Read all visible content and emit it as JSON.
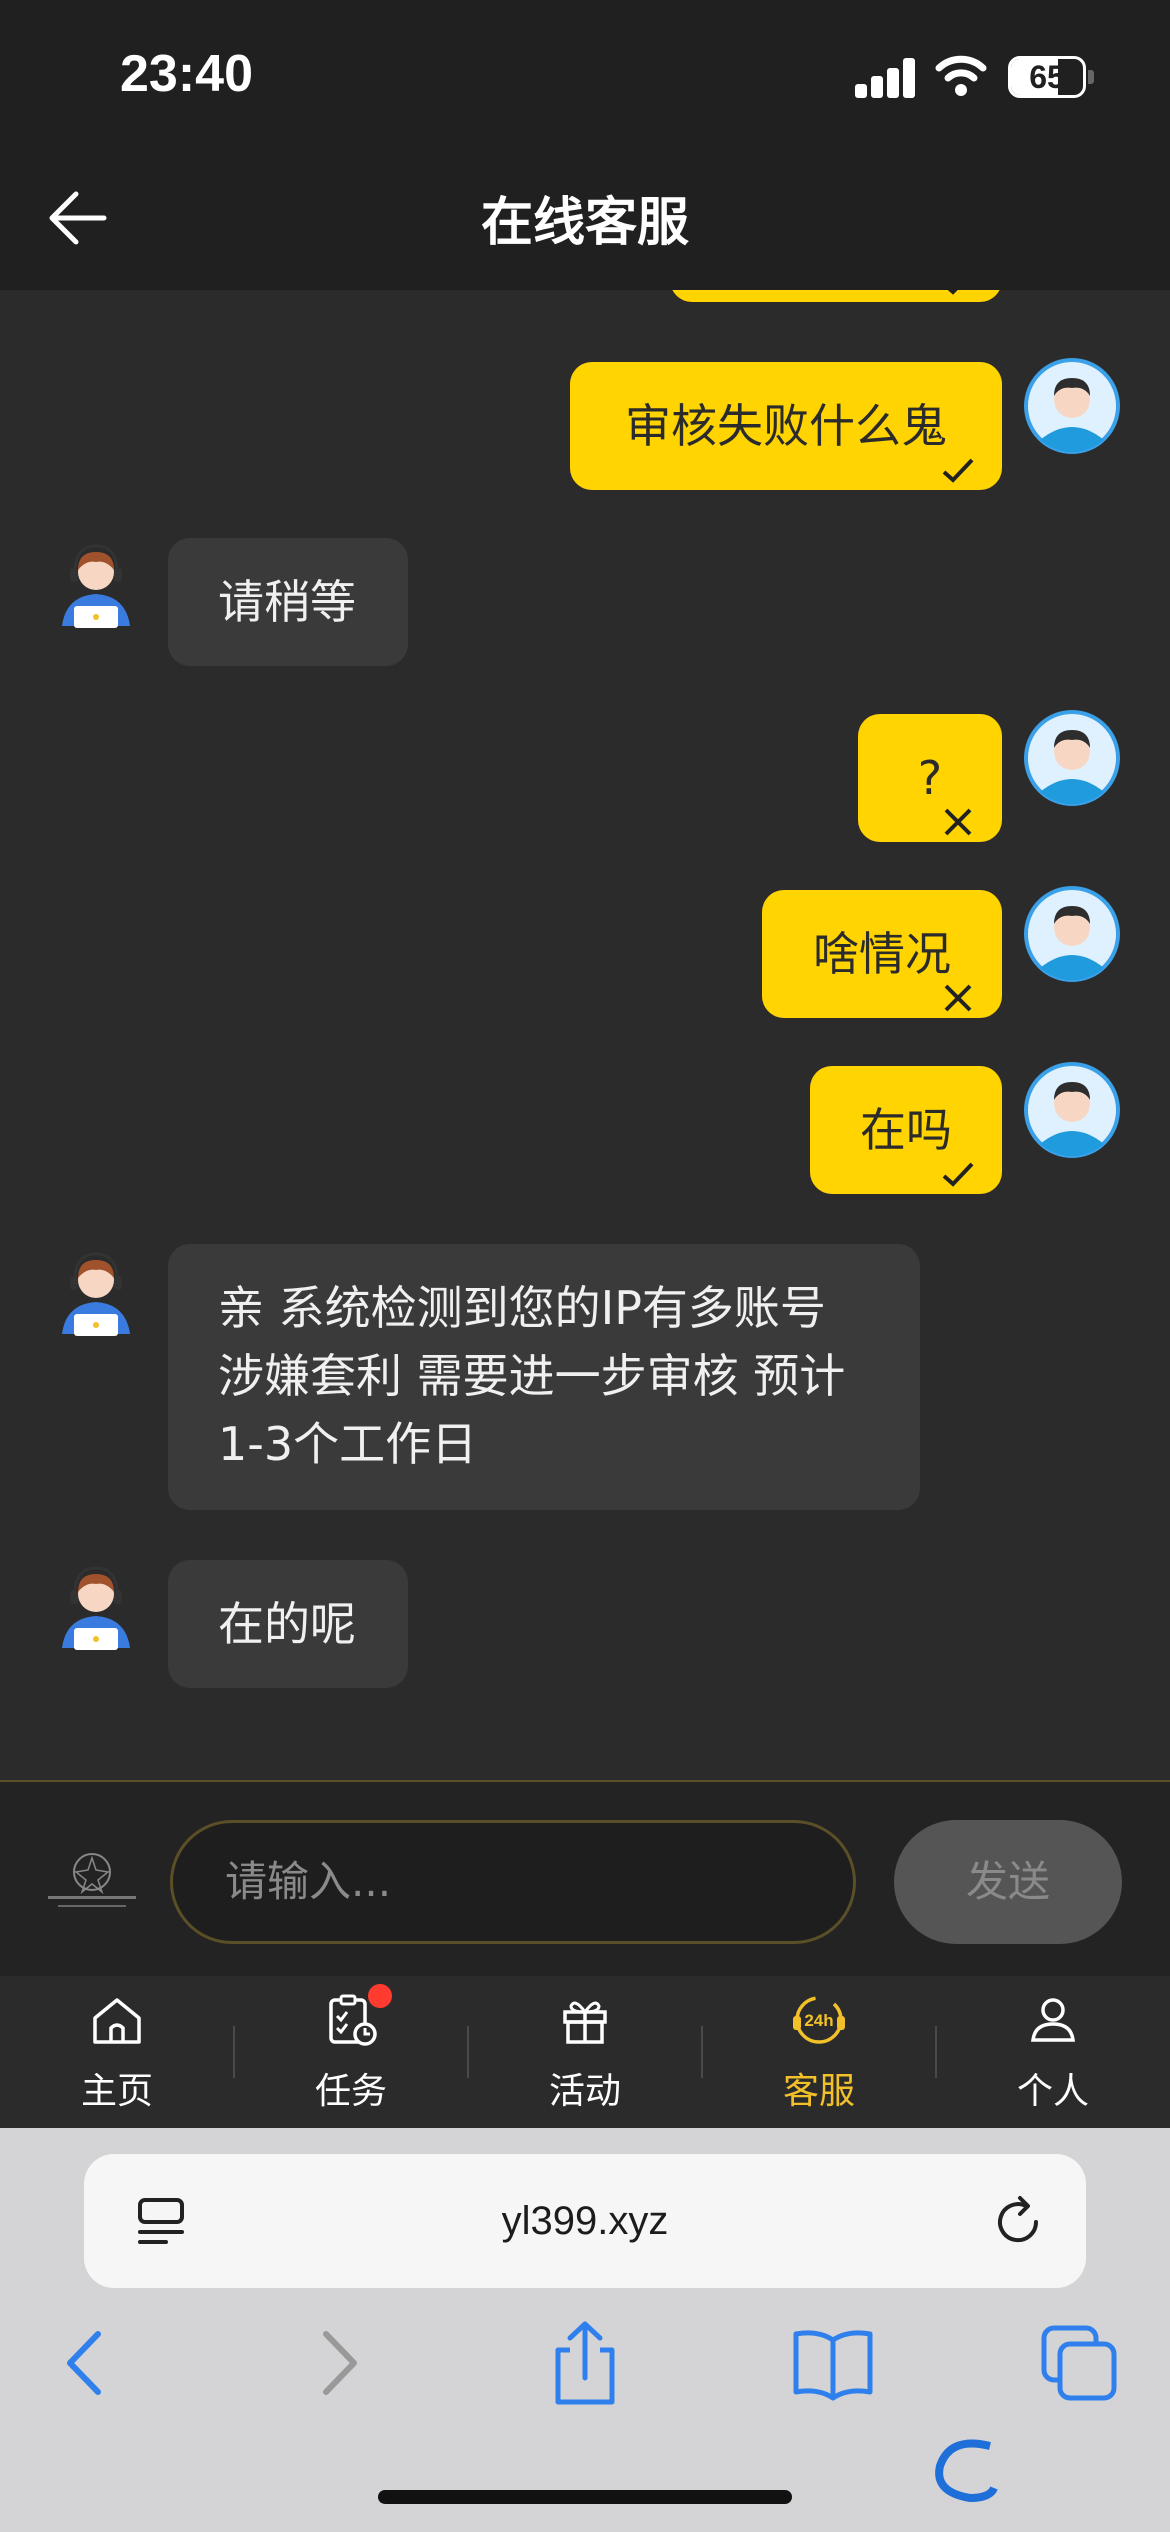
{
  "status_bar": {
    "time": "23:40",
    "battery": "65"
  },
  "header": {
    "title": "在线客服"
  },
  "messages": [
    {
      "sender": "user",
      "text": "审核失败什么鬼",
      "status": "sent"
    },
    {
      "sender": "agent",
      "text": "请稍等"
    },
    {
      "sender": "user",
      "text": "?",
      "status": "failed"
    },
    {
      "sender": "user",
      "text": "啥情况",
      "status": "failed"
    },
    {
      "sender": "user",
      "text": "在吗",
      "status": "sent"
    },
    {
      "sender": "agent",
      "lines": [
        "亲 系统检测到您的IP有多账号",
        "涉嫌套利 需要进一步审核 预计",
        "1-3个工作日"
      ]
    },
    {
      "sender": "agent",
      "text": "在的呢"
    }
  ],
  "composer": {
    "placeholder": "请输入...",
    "send_label": "发送"
  },
  "tabs": [
    {
      "label": "主页",
      "icon": "home-icon"
    },
    {
      "label": "任务",
      "icon": "task-icon",
      "badge": true
    },
    {
      "label": "活动",
      "icon": "gift-icon"
    },
    {
      "label": "客服",
      "icon": "support-24h-icon",
      "active": true
    },
    {
      "label": "个人",
      "icon": "person-icon"
    }
  ],
  "browser": {
    "url": "yl399.xyz"
  },
  "colors": {
    "accent": "#ffd400",
    "tab_active": "#f2c029",
    "agent_bubble": "#3a3a3a",
    "browser_blue": "#2f80ed"
  }
}
